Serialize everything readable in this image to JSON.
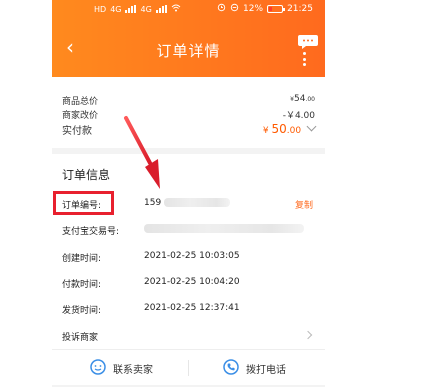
{
  "status_bar": {
    "network_label": "HD",
    "signal_label_1": "4G",
    "signal_label_2": "4G",
    "battery_percent": "12%",
    "time": "21:25"
  },
  "nav": {
    "title": "订单详情"
  },
  "price_summary": {
    "total_label": "商品总价",
    "total_currency": "¥",
    "total_value": "54",
    "total_decimal": ".00",
    "adjust_label": "商家改价",
    "adjust_value": "-￥4.00",
    "actual_label": "实付款",
    "actual_currency": "¥",
    "actual_value": "50",
    "actual_decimal": ".00"
  },
  "order_info": {
    "title": "订单信息",
    "order_no_label": "订单编号:",
    "order_no_prefix": "159",
    "copy_label": "复制",
    "alipay_label": "支付宝交易号:",
    "created_label": "创建时间:",
    "created_value": "2021-02-25 10:03:05",
    "paid_label": "付款时间:",
    "paid_value": "2021-02-25 10:04:20",
    "shipped_label": "发货时间:",
    "shipped_value": "2021-02-25 12:37:41",
    "complaint_label": "投诉商家"
  },
  "actions": {
    "contact_seller": "联系卖家",
    "call_phone": "拨打电话"
  },
  "colors": {
    "brand_orange": "#ff6a1e",
    "highlight_red": "#e8202e"
  }
}
